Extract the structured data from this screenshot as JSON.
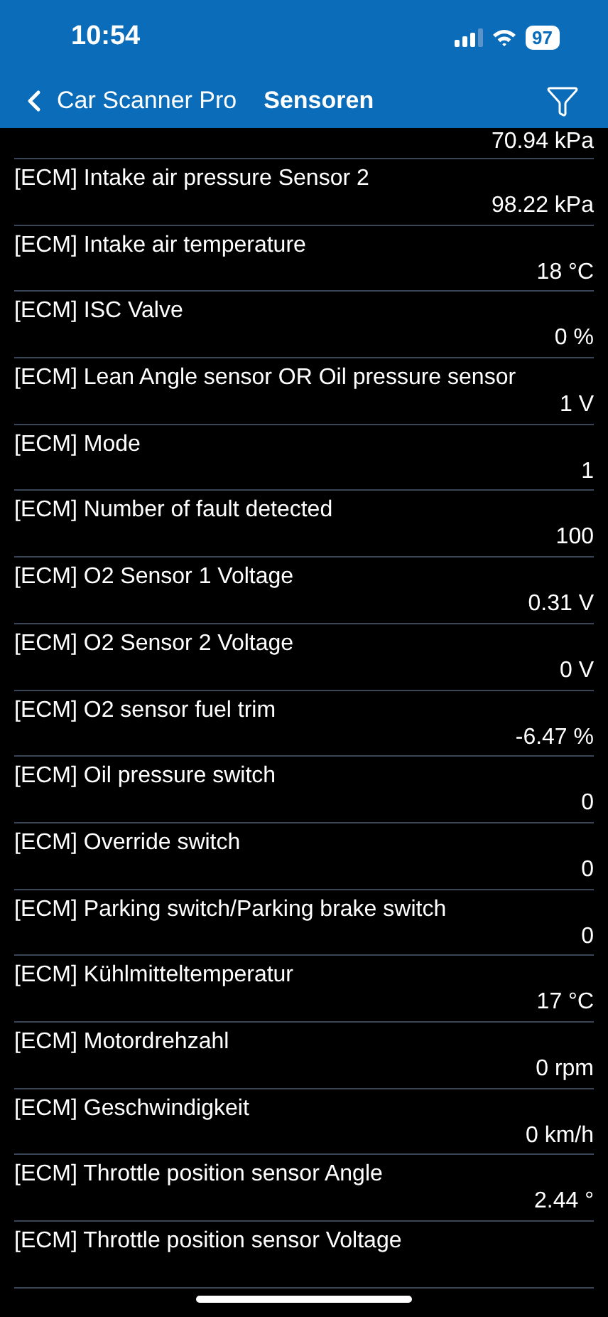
{
  "status_bar": {
    "time": "10:54",
    "battery": "97"
  },
  "nav": {
    "back": "Car Scanner Pro",
    "title": "Sensoren"
  },
  "first_value": "70.94 kPa",
  "sensors": [
    {
      "name": "[ECM] Intake air pressure Sensor 2",
      "value": "98.22 kPa"
    },
    {
      "name": "[ECM] Intake air temperature",
      "value": "18 °C"
    },
    {
      "name": "[ECM] ISC Valve",
      "value": "0 %"
    },
    {
      "name": "[ECM] Lean Angle sensor OR Oil pressure sensor",
      "value": "1 V"
    },
    {
      "name": "[ECM] Mode",
      "value": "1"
    },
    {
      "name": "[ECM] Number of fault detected",
      "value": "100"
    },
    {
      "name": "[ECM] O2 Sensor 1 Voltage",
      "value": "0.31 V"
    },
    {
      "name": "[ECM] O2 Sensor 2 Voltage",
      "value": "0 V"
    },
    {
      "name": "[ECM] O2 sensor fuel trim",
      "value": "-6.47 %"
    },
    {
      "name": "[ECM] Oil pressure switch",
      "value": "0"
    },
    {
      "name": "[ECM] Override switch",
      "value": "0"
    },
    {
      "name": "[ECM] Parking switch/Parking brake switch",
      "value": "0"
    },
    {
      "name": "[ECM] Kühlmitteltemperatur",
      "value": "17 °C"
    },
    {
      "name": "[ECM] Motordrehzahl",
      "value": "0 rpm"
    },
    {
      "name": "[ECM] Geschwindigkeit",
      "value": "0 km/h"
    },
    {
      "name": "[ECM] Throttle position sensor Angle",
      "value": "2.44 °"
    },
    {
      "name": "[ECM] Throttle position sensor Voltage"
    }
  ]
}
